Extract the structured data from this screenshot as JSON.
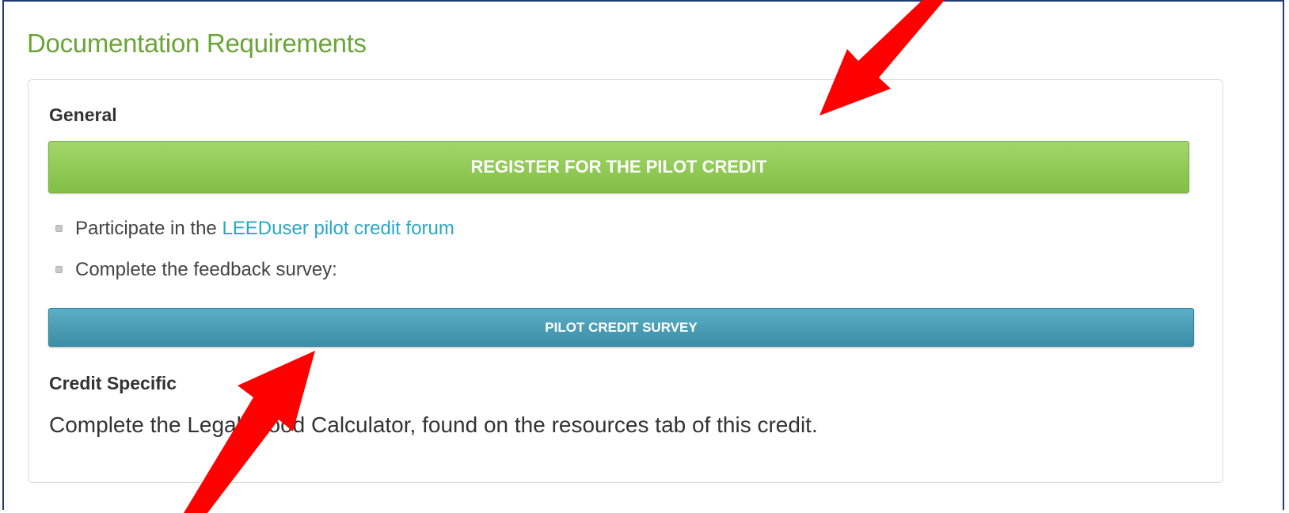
{
  "section": {
    "title": "Documentation Requirements"
  },
  "general": {
    "heading": "General",
    "register_button": "REGISTER FOR THE PILOT CREDIT",
    "items": [
      {
        "prefix": "Participate in the ",
        "link": "LEEDuser pilot credit forum",
        "suffix": ""
      },
      {
        "prefix": "Complete the feedback survey:",
        "link": "",
        "suffix": ""
      }
    ],
    "survey_button": "PILOT CREDIT SURVEY"
  },
  "credit_specific": {
    "heading": "Credit Specific",
    "text": "Complete the Legal Wood Calculator, found on the resources tab of this credit."
  },
  "annotations": {
    "arrow_color": "#ff0000",
    "arrows": [
      "pointer-arrow-top-right",
      "pointer-arrow-bottom-left"
    ]
  },
  "colors": {
    "title_green": "#6aa536",
    "register_green": "#8cc850",
    "survey_blue": "#4a9fb8",
    "link_blue": "#2aa7c6",
    "frame_navy": "#1f3a70"
  }
}
